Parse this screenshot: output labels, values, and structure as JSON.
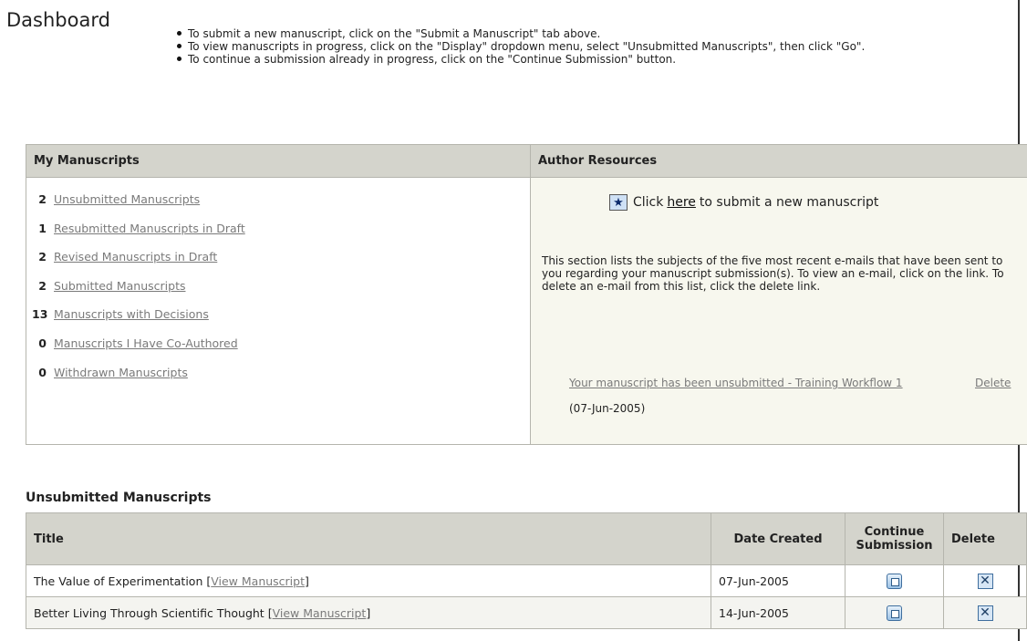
{
  "page": {
    "title": "Dashboard",
    "instructions": [
      "To submit a new manuscript, click on the \"Submit a Manuscript\" tab above.",
      "To view manuscripts in progress, click on the \"Display\" dropdown menu, select \"Unsubmitted Manuscripts\", then click \"Go\".",
      "To continue a submission already in progress, click on the \"Continue Submission\" button."
    ]
  },
  "my_manuscripts": {
    "header": "My Manuscripts",
    "items": [
      {
        "count": "2",
        "label": "Unsubmitted Manuscripts"
      },
      {
        "count": "1",
        "label": "Resubmitted Manuscripts in Draft"
      },
      {
        "count": "2",
        "label": "Revised Manuscripts in Draft"
      },
      {
        "count": "2",
        "label": "Submitted Manuscripts"
      },
      {
        "count": "13",
        "label": "Manuscripts with Decisions"
      },
      {
        "count": "0",
        "label": "Manuscripts I Have Co-Authored"
      },
      {
        "count": "0",
        "label": "Withdrawn Manuscripts"
      }
    ]
  },
  "author_resources": {
    "header": "Author Resources",
    "submit_prefix": "Click",
    "submit_link": "here",
    "submit_suffix": "to submit a new manuscript",
    "description": "This section lists the subjects of the five most recent e-mails that have been sent to you regarding your manuscript submission(s). To view an e-mail, click on the link. To delete an e-mail from this list, click the delete link.",
    "email": {
      "subject": "Your manuscript has been unsubmitted - Training Workflow 1",
      "date": "(07-Jun-2005)",
      "delete_label": "Delete"
    }
  },
  "unsubmitted": {
    "section_title": "Unsubmitted Manuscripts",
    "columns": {
      "title": "Title",
      "date": "Date Created",
      "continue": "Continue Submission",
      "delete": "Delete"
    },
    "rows": [
      {
        "title": "The Value of Experimentation",
        "view_label": "View Manuscript",
        "date": "07-Jun-2005"
      },
      {
        "title": "Better Living Through Scientific Thought",
        "view_label": "View Manuscript",
        "date": "14-Jun-2005"
      }
    ]
  },
  "icons": {
    "submit": "star-icon",
    "continue": "continue-submission-icon",
    "delete": "delete-x-icon"
  }
}
